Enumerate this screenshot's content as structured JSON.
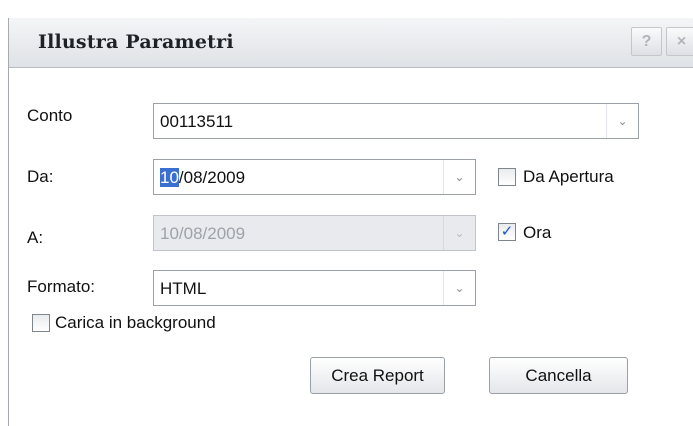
{
  "window": {
    "title": "Illustra Parametri",
    "help_glyph": "?",
    "close_glyph": "×"
  },
  "form": {
    "conto": {
      "label": "Conto",
      "value": "00113511"
    },
    "da": {
      "label": "Da:",
      "value_selected": "10",
      "value_rest": "/08/2009"
    },
    "a": {
      "label": "A:",
      "value": "10/08/2009"
    },
    "formato": {
      "label": "Formato:",
      "value": "HTML"
    },
    "da_apertura": {
      "label": "Da Apertura",
      "checked": false
    },
    "ora": {
      "label": "Ora",
      "checked": true,
      "check_glyph": "✓"
    },
    "carica_background": {
      "label": "Carica in background",
      "checked": false
    },
    "dropdown_glyph": "⌄"
  },
  "buttons": {
    "crea_report": "Crea Report",
    "cancella": "Cancella"
  },
  "colors": {
    "selection": "#3a6fd0",
    "checkmark": "#1f51c7"
  }
}
